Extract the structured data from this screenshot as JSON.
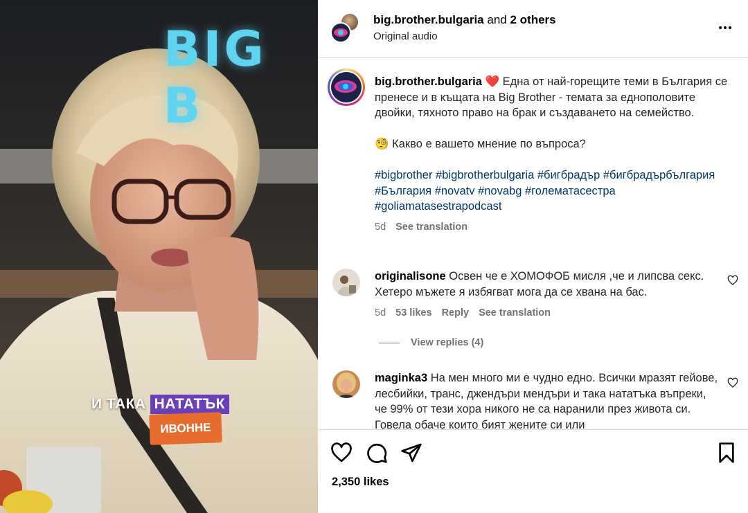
{
  "media": {
    "caption_part1": "И ТАКА",
    "caption_part2": "НАТАТЪК",
    "name_tag": "ИВОННЕ",
    "background_sign": "BIG B"
  },
  "header": {
    "account": "big.brother.bulgaria",
    "and_text": "and",
    "others": "2 others",
    "audio": "Original audio",
    "more_icon": "more-horizontal-icon"
  },
  "post": {
    "username": "big.brother.bulgaria",
    "emoji": "❤️",
    "text": "Една от най-горещите теми в България се пренесе и в къщата на Big Brother - темата за еднополовите двойки, тяхното право на брак и създаването на семейство.",
    "question_emoji": "🧐",
    "question": "Какво е вашето мнение по въпроса?",
    "hashtags": "#bigbrother #bigbrotherbulgaria #бигбрадър #бигбрадърбългария #България #novatv #novabg #голематасестра #goliamatasestrapodcast",
    "age": "5d",
    "see_translation": "See translation"
  },
  "comments": [
    {
      "username": "originalisone",
      "text": "Освен че е ХОМОФОБ мисля ,че и липсва секс. Хетеро мъжете я избягват мога да се хвана на бас.",
      "age": "5d",
      "likes": "53 likes",
      "reply": "Reply",
      "see_translation": "See translation",
      "view_replies": "View replies (4)"
    },
    {
      "username": "maginka3",
      "text": "На мен много ми е чудно едно. Всички мразят гейове, лесбийки, транс, джендъри мендъри и така нататъка въпреки, че 99% от тези хора никого не са наранили през живота си. Говела обаче които бият жените си или"
    }
  ],
  "actions": {
    "like_icon": "heart-icon",
    "comment_icon": "comment-icon",
    "share_icon": "share-icon",
    "save_icon": "bookmark-icon"
  },
  "likes_count": "2,350 likes",
  "colors": {
    "hashtag": "#00376b",
    "caption_highlight": "#6b3fb8",
    "name_tag": "#e66d2e",
    "secondary_text": "#737373"
  }
}
